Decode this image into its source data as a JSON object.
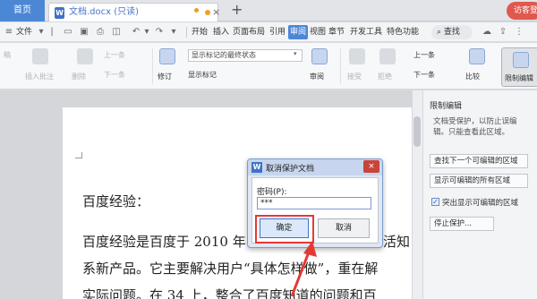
{
  "titlebar": {
    "home_tab": "首页",
    "doc_title": "文档.docx (只读)",
    "close": "×",
    "new_tab": "+",
    "user": "访客登"
  },
  "menubar": {
    "file_menu": "文件",
    "items": [
      "开始",
      "插入",
      "页面布局",
      "引用",
      "审阅",
      "视图",
      "章节",
      "开发工具",
      "特色功能"
    ],
    "active": "审阅",
    "search": "查找"
  },
  "ribbon": {
    "left_items": [
      "稿",
      "插入批注",
      "删除",
      "上一条",
      "下一条"
    ],
    "revise": "修订",
    "markup_state": "显示标记的最终状态",
    "show_markup": "显示标记",
    "review": "审阅",
    "accept": "接受",
    "reject": "拒绝",
    "prev": "上一条",
    "next": "下一条",
    "compare": "比较",
    "restrict": "限制编辑"
  },
  "document": {
    "lines": [
      "百度经验：",
      "百度经验是百度于 2010 年",
      "系新产品。它主要解决用户“具体怎样做”，重在解",
      "实际问题。在 34 上，整合了百度知道的问题和百"
    ],
    "line1_tail": "活知"
  },
  "pane": {
    "title": "限制编辑",
    "desc": "文档受保护，以防止误编辑。只能查看此区域。",
    "btn_next_region": "查找下一个可编辑的区域",
    "btn_all_regions": "显示可编辑的所有区域",
    "highlight_label": "突出显示可编辑的区域",
    "btn_stop": "停止保护..."
  },
  "dialog": {
    "title": "取消保护文档",
    "close": "×",
    "pw_label": "密码(P):",
    "pw_value": "***",
    "ok": "确定",
    "cancel": "取消",
    "icon_letter": "W"
  },
  "colors": {
    "accent": "#4c87d6",
    "highlight_red": "#e53935",
    "tab_blue": "#3f72c8"
  }
}
